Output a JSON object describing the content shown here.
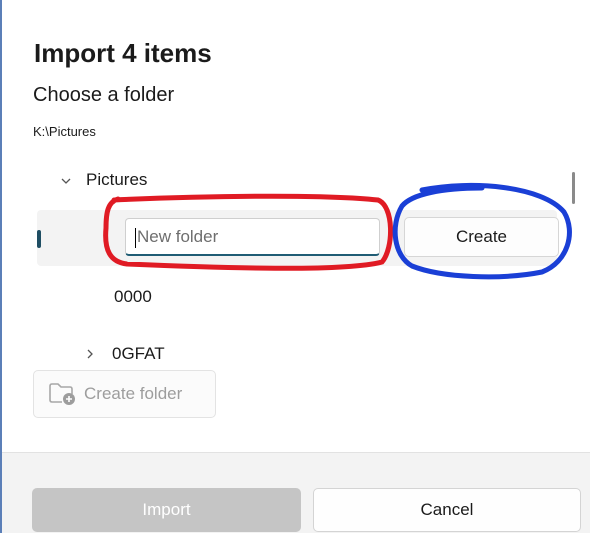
{
  "dialog": {
    "title": "Import 4 items",
    "subtitle": "Choose a folder",
    "path": "K:\\Pictures"
  },
  "tree": {
    "items": [
      {
        "label": "Pictures",
        "expanded": true,
        "chevron": "chevron-down-icon"
      },
      {
        "label": "0000"
      },
      {
        "label": "0GFAT",
        "expanded": false,
        "chevron": "chevron-right-icon"
      }
    ],
    "new_folder": {
      "placeholder": "New folder",
      "value": "",
      "create_label": "Create"
    }
  },
  "create_folder": {
    "label": "Create folder",
    "icon": "new-folder-icon",
    "disabled": true
  },
  "footer": {
    "import_label": "Import",
    "cancel_label": "Cancel"
  },
  "annotations": {
    "red_circle_color": "#e01b24",
    "blue_circle_color": "#1a3fd6"
  },
  "colors": {
    "accent": "#1f5c74",
    "footer_bg": "#f3f3f3",
    "disabled_button": "#c5c5c5"
  }
}
